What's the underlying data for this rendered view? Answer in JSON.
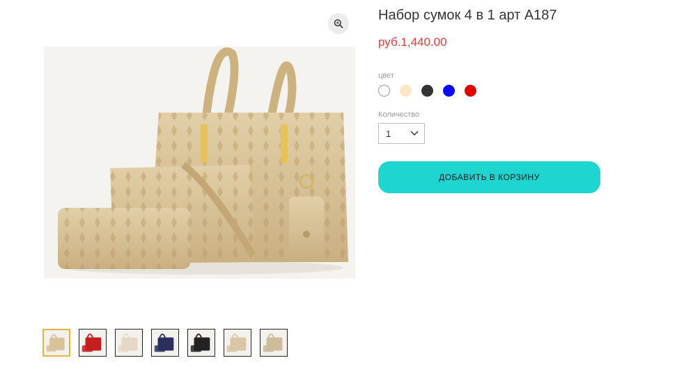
{
  "product": {
    "title": "Набор сумок 4 в 1 арт A187",
    "price": "руб.1,440.00"
  },
  "options": {
    "color_label": "цвет",
    "colors": [
      {
        "name": "white",
        "hex": "#ffffff"
      },
      {
        "name": "beige",
        "hex": "#fbe8c2"
      },
      {
        "name": "black",
        "hex": "#333333"
      },
      {
        "name": "blue",
        "hex": "#0a0af5"
      },
      {
        "name": "red",
        "hex": "#e00000"
      }
    ],
    "quantity_label": "Количество",
    "quantity_value": "1"
  },
  "actions": {
    "add_to_cart": "ДОБАВИТЬ В КОРЗИНУ"
  },
  "gallery": {
    "zoom_icon": "magnifier-icon",
    "selected_index": 0,
    "thumbnails": [
      {
        "name": "beige-set",
        "color": "#d8c29a"
      },
      {
        "name": "red-set",
        "color": "#c41f1f"
      },
      {
        "name": "cream-set",
        "color": "#e6d8c6"
      },
      {
        "name": "navy-set",
        "color": "#2c2f5c"
      },
      {
        "name": "black-set",
        "color": "#222222"
      },
      {
        "name": "beige-clutch",
        "color": "#d9c6a7"
      },
      {
        "name": "beige-tote",
        "color": "#cdbb99"
      }
    ]
  }
}
